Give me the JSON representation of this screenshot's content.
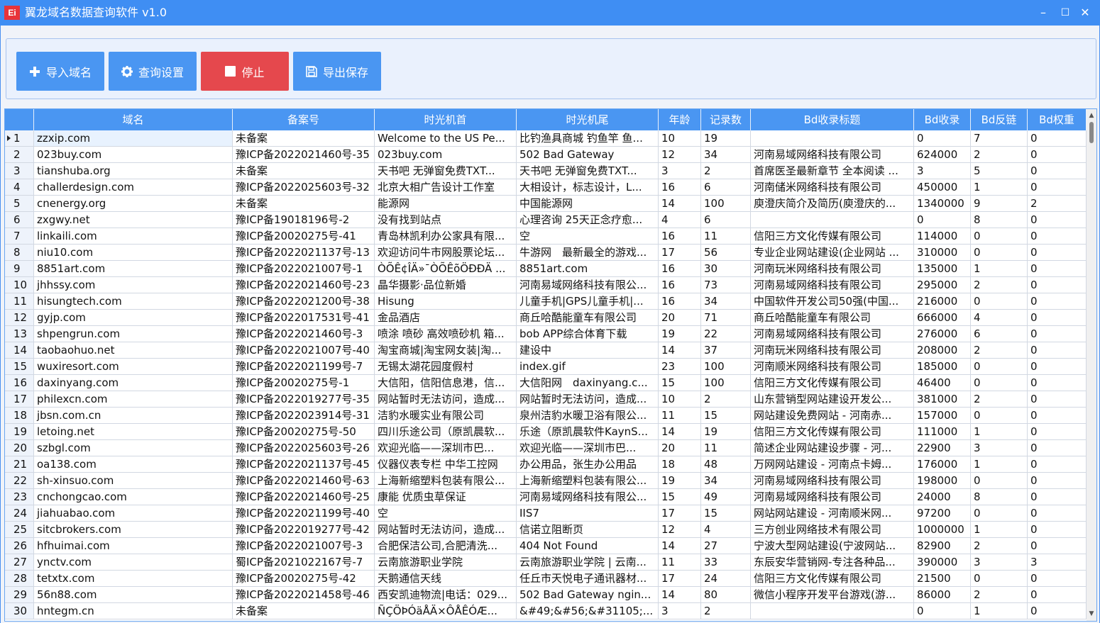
{
  "window": {
    "title": "翼龙域名数据查询软件 v1.0",
    "logo_text": "Ei",
    "minimize": "–",
    "maximize": "☐",
    "close": "✕"
  },
  "toolbar": {
    "import_label": "导入域名",
    "settings_label": "查询设置",
    "stop_label": "停止",
    "export_label": "导出保存"
  },
  "colors": {
    "title_bar": "#3f8ef3",
    "button_blue": "#4a96f2",
    "button_red": "#e5484d",
    "header_bg": "#4a96f2"
  },
  "table": {
    "columns": [
      "域名",
      "备案号",
      "时光机首",
      "时光机尾",
      "年龄",
      "记录数",
      "Bd收录标题",
      "Bd收录",
      "Bd反链",
      "Bd权重"
    ],
    "current_row": 1,
    "rows": [
      [
        "1",
        "zzxip.com",
        "未备案",
        "Welcome to the US Pe...",
        "比钓渔具商城 钓鱼竿 鱼...",
        "10",
        "19",
        "",
        "0",
        "7",
        "0"
      ],
      [
        "2",
        "023buy.com",
        "豫ICP备2022021460号-35",
        "023buy.com",
        "502 Bad Gateway",
        "12",
        "34",
        "河南易域网络科技有限公司",
        "624000",
        "2",
        "0"
      ],
      [
        "3",
        "tianshuba.org",
        "未备案",
        "天书吧 无弹窗免费TXT...",
        "天书吧 无弹窗免费TXT...",
        "3",
        "2",
        "首席医圣最新章节 全本阅读 ...",
        "3",
        "5",
        "0"
      ],
      [
        "4",
        "challerdesign.com",
        "豫ICP备2022025603号-32",
        "北京大相广告设计工作室",
        "大相设计，标志设计，L...",
        "16",
        "6",
        "河南储米网络科技有限公司",
        "450000",
        "1",
        "0"
      ],
      [
        "5",
        "cnenergy.org",
        "未备案",
        "能源网",
        "中国能源网",
        "14",
        "100",
        "庾澄庆简介及简历(庾澄庆的...",
        "1340000",
        "9",
        "2"
      ],
      [
        "6",
        "zxgwy.net",
        "豫ICP备19018196号-2",
        "没有找到站点",
        "心理咨询 25天正念疗愈...",
        "4",
        "6",
        "",
        "0",
        "8",
        "0"
      ],
      [
        "7",
        "linkaili.com",
        "豫ICP备20020275号-41",
        "青岛林凯利办公家具有限...",
        "空",
        "16",
        "11",
        "信阳三方文化传媒有限公司",
        "114000",
        "0",
        "0"
      ],
      [
        "8",
        "niu10.com",
        "豫ICP备2022021137号-13",
        "欢迎访问牛市网股票论坛...",
        "牛游网　最新最全的游戏...",
        "17",
        "56",
        "专业企业网站建设(企业网站 ...",
        "310000",
        "0",
        "0"
      ],
      [
        "9",
        "8851art.com",
        "豫ICP备2022021007号-1",
        "ÒÕÊ¢ÎÄ»¯ÒÕÊõÖÐÐÄ ...",
        "8851art.com",
        "16",
        "30",
        "河南玩米网络科技有限公司",
        "135000",
        "1",
        "0"
      ],
      [
        "10",
        "jhhssy.com",
        "豫ICP备2022021460号-23",
        "晶华摄影·品位新婚",
        "河南易域网络科技有限公...",
        "16",
        "73",
        "河南易域网络科技有限公司",
        "295000",
        "2",
        "0"
      ],
      [
        "11",
        "hisungtech.com",
        "豫ICP备2022021200号-38",
        "Hisung",
        "儿童手机|GPS儿童手机|...",
        "16",
        "34",
        "中国软件开发公司50强(中国...",
        "216000",
        "0",
        "0"
      ],
      [
        "12",
        "gyjp.com",
        "豫ICP备2022017531号-41",
        "金品酒店",
        "商丘哈酷能童车有限公司",
        "20",
        "71",
        "商丘哈酷能童车有限公司",
        "666000",
        "4",
        "0"
      ],
      [
        "13",
        "shpengrun.com",
        "豫ICP备2022021460号-3",
        "喷涂 喷砂 高效喷砂机 箱...",
        "bob APP综合体育下载",
        "19",
        "22",
        "河南易域网络科技有限公司",
        "276000",
        "6",
        "0"
      ],
      [
        "14",
        "taobaohuo.net",
        "豫ICP备2022021007号-40",
        "淘宝商城|淘宝网女装|淘...",
        "建设中",
        "14",
        "37",
        "河南玩米网络科技有限公司",
        "208000",
        "2",
        "0"
      ],
      [
        "15",
        "wuxiresort.com",
        "豫ICP备2022021199号-7",
        "无锡太湖花园度假村",
        "index.gif",
        "23",
        "100",
        "河南顺米网络科技有限公司",
        "185000",
        "0",
        "0"
      ],
      [
        "16",
        "daxinyang.com",
        "豫ICP备20020275号-1",
        "大信阳，信阳信息港，信...",
        "大信阳网　daxinyang.c...",
        "15",
        "100",
        "信阳三方文化传媒有限公司",
        "46400",
        "0",
        "0"
      ],
      [
        "17",
        "philexcn.com",
        "豫ICP备2022019277号-35",
        "网站暂时无法访问，造成...",
        "网站暂时无法访问，造成...",
        "10",
        "2",
        "山东营销型网站建设开发公...",
        "381000",
        "2",
        "0"
      ],
      [
        "18",
        "jbsn.com.cn",
        "豫ICP备2022023914号-31",
        "洁豹水暖实业有限公司",
        "泉州洁豹水暖卫浴有限公...",
        "11",
        "15",
        "网站建设免费网站 - 河南赤...",
        "157000",
        "0",
        "0"
      ],
      [
        "19",
        "letoing.net",
        "豫ICP备20020275号-50",
        "四川乐途公司（原凯晨软...",
        "乐途（原凯晨软件KaynS...",
        "14",
        "19",
        "信阳三方文化传媒有限公司",
        "111000",
        "1",
        "0"
      ],
      [
        "20",
        "szbgl.com",
        "豫ICP备2022025603号-26",
        "欢迎光临——深圳市巴...",
        "欢迎光临——深圳市巴...",
        "20",
        "11",
        "简述企业网站建设步骤 - 河...",
        "22900",
        "3",
        "0"
      ],
      [
        "21",
        "oa138.com",
        "豫ICP备2022021137号-45",
        "仪器仪表专栏 中华工控网",
        "办公用品，张生办公用品",
        "18",
        "48",
        "万网网站建设 - 河南点卡姆...",
        "176000",
        "1",
        "0"
      ],
      [
        "22",
        "sh-xinsuo.com",
        "豫ICP备2022021460号-63",
        "上海新缩塑料包装有限公...",
        "上海新缩塑料包装有限公...",
        "19",
        "34",
        "河南易域网络科技有限公司",
        "198000",
        "0",
        "0"
      ],
      [
        "23",
        "cnchongcao.com",
        "豫ICP备2022021460号-25",
        "康能 优质虫草保证",
        "河南易域网络科技有限公...",
        "15",
        "49",
        "河南易域网络科技有限公司",
        "24000",
        "8",
        "0"
      ],
      [
        "24",
        "jiahuabao.com",
        "豫ICP备2022021199号-40",
        "空",
        "IIS7",
        "17",
        "15",
        "网站网站建设 - 河南顺米网...",
        "97200",
        "0",
        "0"
      ],
      [
        "25",
        "sitcbrokers.com",
        "豫ICP备2022019277号-42",
        "网站暂时无法访问，造成...",
        "信诺立阻断页",
        "12",
        "4",
        "三方创业网络技术有限公司",
        "1000000",
        "1",
        "0"
      ],
      [
        "26",
        "hfhuimai.com",
        "豫ICP备2022021007号-3",
        "合肥保洁公司,合肥清洗...",
        "404 Not Found",
        "14",
        "27",
        "宁波大型网站建设(宁波网站...",
        "82900",
        "2",
        "0"
      ],
      [
        "27",
        "ynctv.com",
        "蜀ICP备2021022167号-7",
        "云南旅游职业学院",
        "云南旅游职业学院 | 云南...",
        "11",
        "33",
        "东辰安华营销网-专注各种品...",
        "390000",
        "3",
        "3"
      ],
      [
        "28",
        "tetxtx.com",
        "豫ICP备20020275号-42",
        "天鹅通信天线",
        "任丘市天悦电子通讯器材...",
        "17",
        "24",
        "信阳三方文化传媒有限公司",
        "21500",
        "0",
        "0"
      ],
      [
        "29",
        "56n88.com",
        "豫ICP备2022021458号-46",
        "西安凯迪物流|电话：029...",
        "502 Bad Gateway ngin...",
        "14",
        "80",
        "微信小程序开发平台游戏(游...",
        "86000",
        "2",
        "0"
      ],
      [
        "30",
        "hntegm.cn",
        "未备案",
        "ÑÇÖÞÓäÅÄ×ÔÅÊÓÆ...",
        "&#49;&#56;&#31105;...",
        "3",
        "2",
        "",
        "0",
        "1",
        "0"
      ]
    ]
  }
}
